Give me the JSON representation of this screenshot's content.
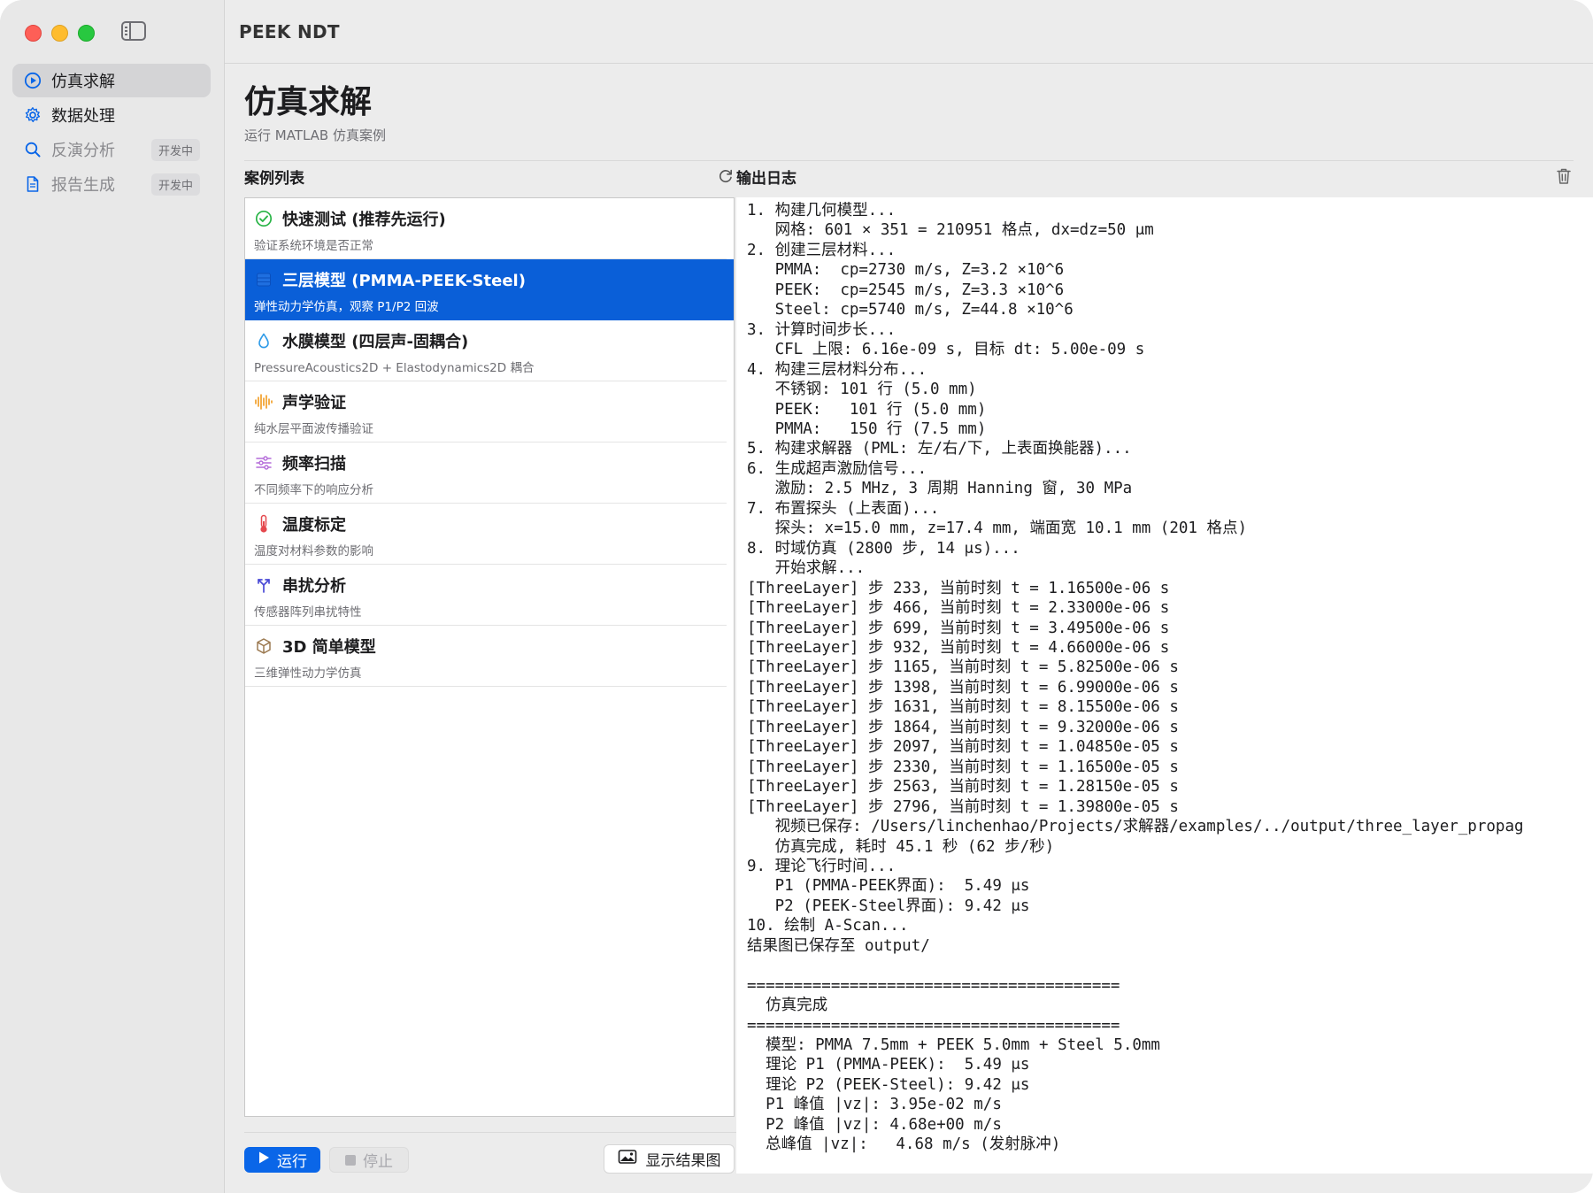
{
  "app": {
    "title": "PEEK NDT"
  },
  "sidebar": {
    "items": [
      {
        "label": "仿真求解",
        "icon": "play-circle-icon",
        "selected": true,
        "badge": ""
      },
      {
        "label": "数据处理",
        "icon": "gear-icon",
        "selected": false,
        "badge": ""
      },
      {
        "label": "反演分析",
        "icon": "search-icon",
        "selected": false,
        "badge": "开发中"
      },
      {
        "label": "报告生成",
        "icon": "document-icon",
        "selected": false,
        "badge": "开发中"
      }
    ]
  },
  "page": {
    "title": "仿真求解",
    "subtitle": "运行 MATLAB 仿真案例"
  },
  "case_list": {
    "title": "案例列表",
    "items": [
      {
        "title": "快速测试 (推荐先运行)",
        "desc": "验证系统环境是否正常",
        "icon": "checkmark-circle-icon",
        "selected": false
      },
      {
        "title": "三层模型 (PMMA-PEEK-Steel)",
        "desc": "弹性动力学仿真，观察 P1/P2 回波",
        "icon": "layers-icon",
        "selected": true
      },
      {
        "title": "水膜模型 (四层声-固耦合)",
        "desc": "PressureAcoustics2D + Elastodynamics2D 耦合",
        "icon": "water-drop-icon",
        "selected": false
      },
      {
        "title": "声学验证",
        "desc": "纯水层平面波传播验证",
        "icon": "waveform-icon",
        "selected": false
      },
      {
        "title": "频率扫描",
        "desc": "不同频率下的响应分析",
        "icon": "sliders-icon",
        "selected": false
      },
      {
        "title": "温度标定",
        "desc": "温度对材料参数的影响",
        "icon": "thermometer-icon",
        "selected": false
      },
      {
        "title": "串扰分析",
        "desc": "传感器阵列串扰特性",
        "icon": "split-arrows-icon",
        "selected": false
      },
      {
        "title": "3D 简单模型",
        "desc": "三维弹性动力学仿真",
        "icon": "cube-icon",
        "selected": false
      }
    ]
  },
  "buttons": {
    "run": "运行",
    "stop": "停止",
    "show_result": "显示结果图"
  },
  "log": {
    "title": "输出日志",
    "text": "1. 构建几何模型...\n   网格: 601 × 351 = 210951 格点, dx=dz=50 μm\n2. 创建三层材料...\n   PMMA:  cp=2730 m/s, Z=3.2 ×10^6\n   PEEK:  cp=2545 m/s, Z=3.3 ×10^6\n   Steel: cp=5740 m/s, Z=44.8 ×10^6\n3. 计算时间步长...\n   CFL 上限: 6.16e-09 s, 目标 dt: 5.00e-09 s\n4. 构建三层材料分布...\n   不锈钢: 101 行 (5.0 mm)\n   PEEK:   101 行 (5.0 mm)\n   PMMA:   150 行 (7.5 mm)\n5. 构建求解器 (PML: 左/右/下, 上表面换能器)...\n6. 生成超声激励信号...\n   激励: 2.5 MHz, 3 周期 Hanning 窗, 30 MPa\n7. 布置探头 (上表面)...\n   探头: x=15.0 mm, z=17.4 mm, 端面宽 10.1 mm (201 格点)\n8. 时域仿真 (2800 步, 14 μs)...\n   开始求解...\n[ThreeLayer] 步 233, 当前时刻 t = 1.16500e-06 s\n[ThreeLayer] 步 466, 当前时刻 t = 2.33000e-06 s\n[ThreeLayer] 步 699, 当前时刻 t = 3.49500e-06 s\n[ThreeLayer] 步 932, 当前时刻 t = 4.66000e-06 s\n[ThreeLayer] 步 1165, 当前时刻 t = 5.82500e-06 s\n[ThreeLayer] 步 1398, 当前时刻 t = 6.99000e-06 s\n[ThreeLayer] 步 1631, 当前时刻 t = 8.15500e-06 s\n[ThreeLayer] 步 1864, 当前时刻 t = 9.32000e-06 s\n[ThreeLayer] 步 2097, 当前时刻 t = 1.04850e-05 s\n[ThreeLayer] 步 2330, 当前时刻 t = 1.16500e-05 s\n[ThreeLayer] 步 2563, 当前时刻 t = 1.28150e-05 s\n[ThreeLayer] 步 2796, 当前时刻 t = 1.39800e-05 s\n   视频已保存: /Users/linchenhao/Projects/求解器/examples/../output/three_layer_propag\n   仿真完成, 耗时 45.1 秒 (62 步/秒)\n9. 理论飞行时间...\n   P1 (PMMA-PEEK界面):  5.49 μs\n   P2 (PEEK-Steel界面): 9.42 μs\n10. 绘制 A-Scan...\n结果图已保存至 output/\n\n========================================\n  仿真完成\n========================================\n  模型: PMMA 7.5mm + PEEK 5.0mm + Steel 5.0mm\n  理论 P1 (PMMA-PEEK):  5.49 μs\n  理论 P2 (PEEK-Steel): 9.42 μs\n  P1 峰值 |vz|: 3.95e-02 m/s\n  P2 峰值 |vz|: 4.68e+00 m/s\n  总峰值 |vz|:   4.68 m/s (发射脉冲)"
  },
  "colors": {
    "accent": "#0a66e8",
    "selected_row": "#0a5fd8",
    "badge_bg": "#dcdcde"
  }
}
